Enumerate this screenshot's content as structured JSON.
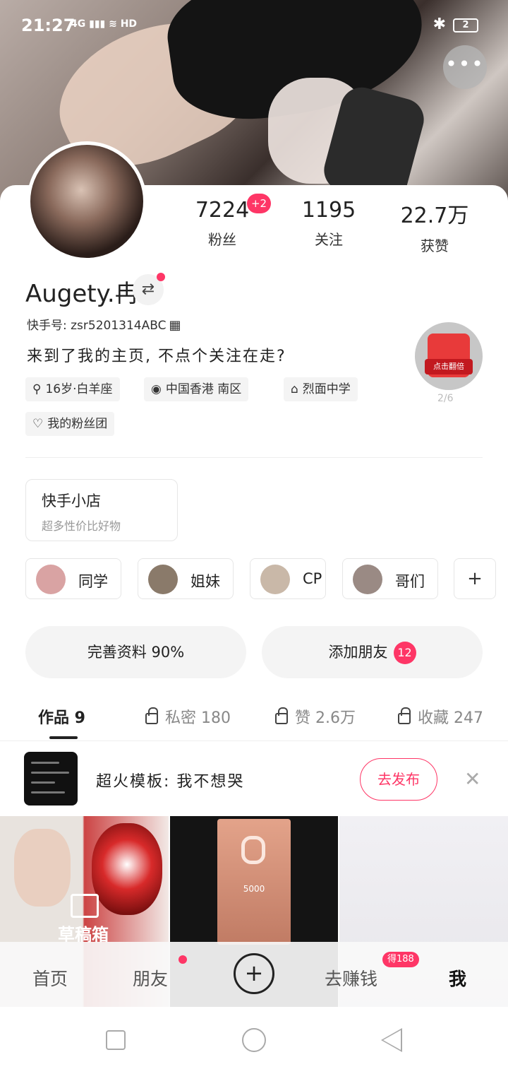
{
  "status": {
    "time": "21:27",
    "signal": "4G",
    "hd": "HD",
    "battery": "2"
  },
  "header": {
    "more_label": "•••"
  },
  "stats": [
    {
      "value": "7224",
      "label": "粉丝",
      "badge": "+2"
    },
    {
      "value": "1195",
      "label": "关注"
    },
    {
      "value": "22.7万",
      "label": "获赞"
    }
  ],
  "profile": {
    "name": "Augety.冉",
    "kuaishou_id": "快手号: zsr5201314ABC",
    "bio": "来到了我的主页, 不点个关注在走?",
    "tags": [
      {
        "icon": "⚲",
        "text": "16岁·白羊座"
      },
      {
        "icon": "◉",
        "text": "中国香港 南区"
      },
      {
        "icon": "⌂",
        "text": "烈面中学"
      },
      {
        "icon": "♡",
        "text": "我的粉丝团"
      }
    ]
  },
  "redpack": {
    "label": "点击翻倍",
    "count": "2/6"
  },
  "shop": {
    "title": "快手小店",
    "subtitle": "超多性价比好物"
  },
  "groups": [
    {
      "label": "同学",
      "color": "#d9a3a3"
    },
    {
      "label": "姐妹",
      "color": "#8a7a6a"
    },
    {
      "label": "CP",
      "color": "#c9b8a8"
    },
    {
      "label": "哥们",
      "color": "#9a8a84"
    }
  ],
  "actions": {
    "complete_profile": "完善资料 90%",
    "add_friend": "添加朋友",
    "add_friend_badge": "12"
  },
  "tabs": {
    "works": "作品 9",
    "private": "私密 180",
    "likes": "赞 2.6万",
    "favorites": "收藏 247"
  },
  "template": {
    "text": "超火模板: 我不想哭",
    "button": "去发布"
  },
  "grid": {
    "drafts": "草稿箱",
    "plaque_value": "5000"
  },
  "bottom_nav": {
    "home": "首页",
    "friends": "朋友",
    "earn": "去赚钱",
    "earn_badge": "得188",
    "me": "我"
  },
  "colors": {
    "accent": "#fe3666"
  }
}
